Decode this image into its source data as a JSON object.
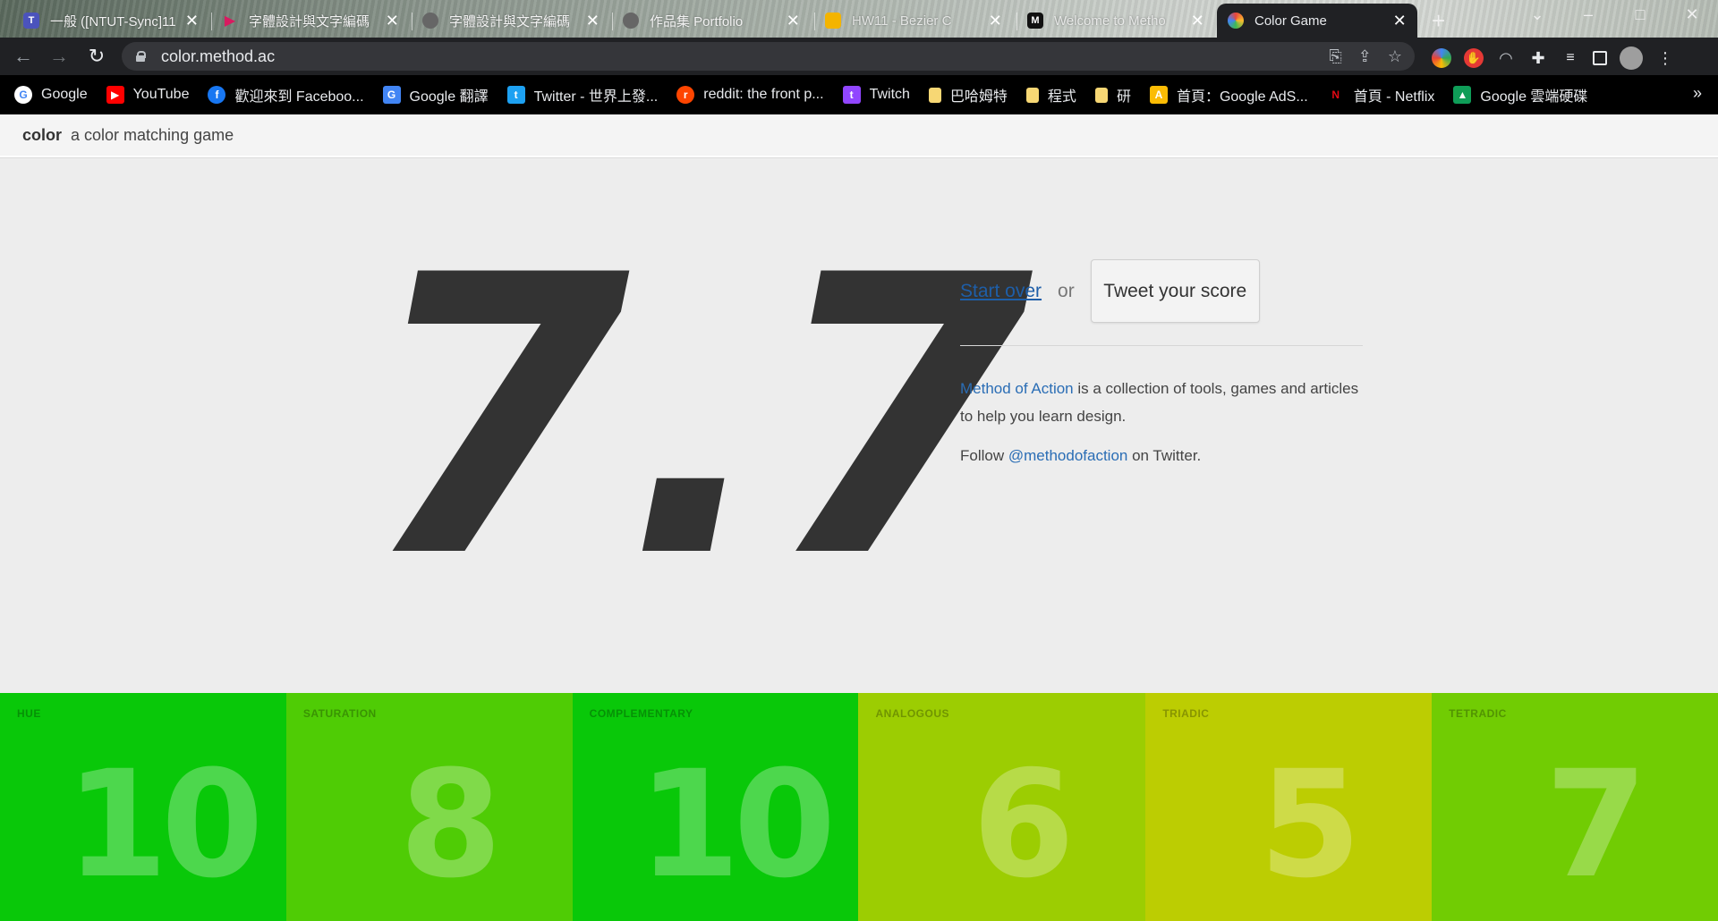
{
  "browser": {
    "tabs": [
      {
        "title": "一般 ([NTUT-Sync]11",
        "icon": "teams-icon",
        "color": "#4b53bc"
      },
      {
        "title": "字體設計與文字編碼",
        "icon": "triangle-icon",
        "color": "#d81b60"
      },
      {
        "title": "字體設計與文字編碼",
        "icon": "globe-icon",
        "color": "#666666"
      },
      {
        "title": "作品集 Portfolio",
        "icon": "globe-icon",
        "color": "#666666"
      },
      {
        "title": "HW11 - Bezier C",
        "icon": "slides-icon",
        "color": "#f4b400"
      },
      {
        "title": "Welcome to Metho",
        "icon": "method-logo-icon",
        "color": "#111111"
      },
      {
        "title": "Color Game",
        "icon": "color-wheel-icon",
        "color": "#e8453c"
      }
    ],
    "url": "color.method.ac",
    "bookmarks": [
      {
        "label": "Google",
        "icon": "google-icon",
        "color": "#ffffff",
        "glyph": "G"
      },
      {
        "label": "YouTube",
        "icon": "youtube-icon",
        "color": "#ff0000",
        "glyph": "▶"
      },
      {
        "label": "歡迎來到 Faceboo...",
        "icon": "facebook-icon",
        "color": "#1877f2",
        "glyph": "f"
      },
      {
        "label": "Google 翻譯",
        "icon": "translate-icon",
        "color": "#4285f4",
        "glyph": "G"
      },
      {
        "label": "Twitter - 世界上發...",
        "icon": "twitter-icon",
        "color": "#1da1f2",
        "glyph": "t"
      },
      {
        "label": "reddit: the front p...",
        "icon": "reddit-icon",
        "color": "#ff4500",
        "glyph": "r"
      },
      {
        "label": "Twitch",
        "icon": "twitch-icon",
        "color": "#9146ff",
        "glyph": "t"
      },
      {
        "label": "巴哈姆特",
        "icon": "folder-icon",
        "color": "#f7d774",
        "glyph": ""
      },
      {
        "label": "程式",
        "icon": "folder-icon",
        "color": "#f7d774",
        "glyph": ""
      },
      {
        "label": "研",
        "icon": "folder-icon",
        "color": "#f7d774",
        "glyph": ""
      },
      {
        "label": "首頁：Google AdS...",
        "icon": "google-ads-icon",
        "color": "#fbbc04",
        "glyph": "A"
      },
      {
        "label": "首頁 - Netflix",
        "icon": "netflix-icon",
        "color": "#000000",
        "glyph": "N"
      },
      {
        "label": "Google 雲端硬碟",
        "icon": "google-drive-icon",
        "color": "#0f9d58",
        "glyph": "▲"
      }
    ]
  },
  "site": {
    "brand": "color",
    "tagline": "a color matching game"
  },
  "score": "7.7",
  "actions": {
    "start_over": "Start over",
    "or": "or",
    "tweet": "Tweet your score"
  },
  "about": {
    "link": "Method of Action",
    "text": " is a collection of tools, games and articles to help you learn design."
  },
  "follow": {
    "prefix": "Follow ",
    "handle": "@methodofaction",
    "suffix": " on Twitter."
  },
  "tiles": [
    {
      "label": "HUE",
      "score": "10",
      "color": "#09c809"
    },
    {
      "label": "SATURATION",
      "score": "8",
      "color": "#4fcc05"
    },
    {
      "label": "COMPLEMENTARY",
      "score": "10",
      "color": "#09c809"
    },
    {
      "label": "ANALOGOUS",
      "score": "6",
      "color": "#9ccd02"
    },
    {
      "label": "TRIADIC",
      "score": "5",
      "color": "#bccd02"
    },
    {
      "label": "TETRADIC",
      "score": "7",
      "color": "#71cc03"
    }
  ]
}
